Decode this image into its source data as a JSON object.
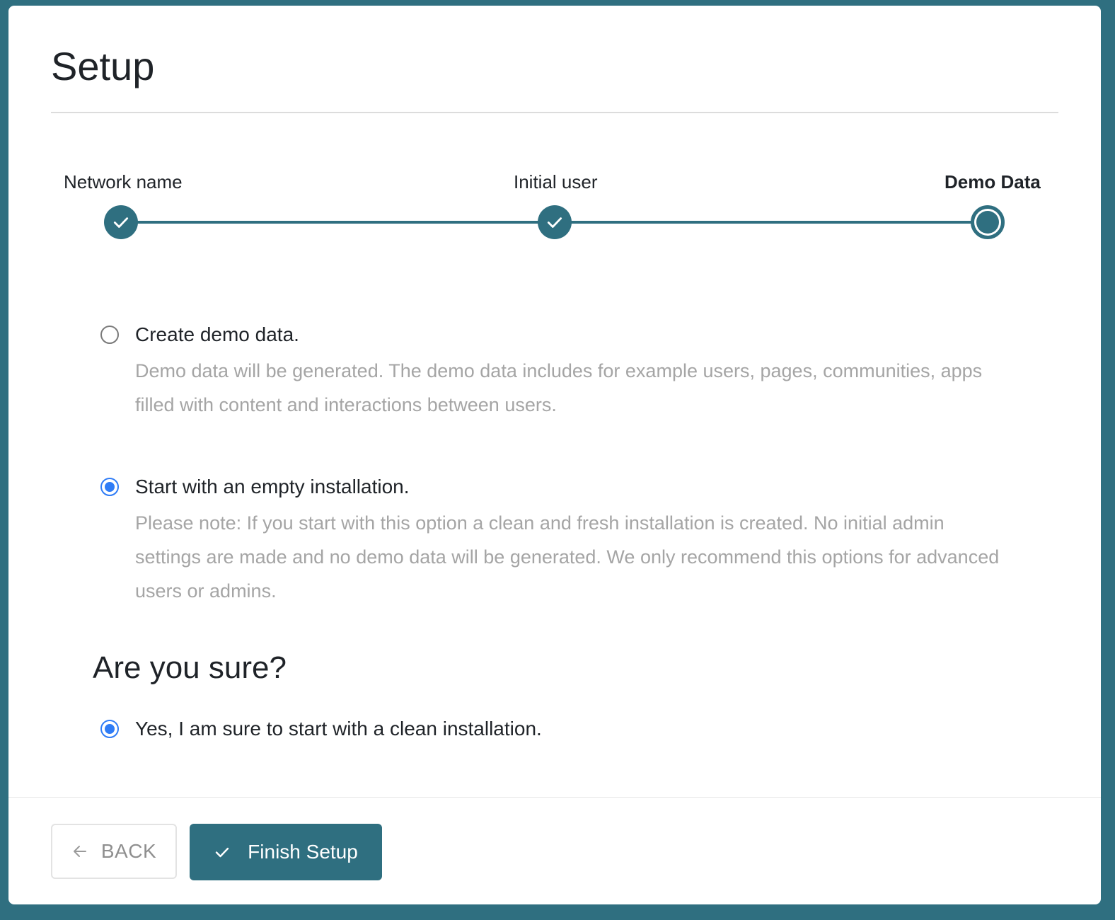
{
  "page": {
    "title": "Setup"
  },
  "stepper": {
    "steps": [
      {
        "label": "Network name",
        "state": "done"
      },
      {
        "label": "Initial user",
        "state": "done"
      },
      {
        "label": "Demo Data",
        "state": "current"
      }
    ],
    "accent_color": "#2f6f80",
    "check_icon": "check-icon"
  },
  "options": [
    {
      "label": "Create demo data.",
      "description": "Demo data will be generated. The demo data includes for example users, pages, communities, apps filled with content and interactions between users.",
      "selected": false
    },
    {
      "label": "Start with an empty installation.",
      "description": "Please note: If you start with this option a clean and fresh installation is created. No initial admin settings are made and no demo data will be generated. We only recommend this options for advanced users or admins.",
      "selected": true
    }
  ],
  "confirm": {
    "title": "Are you sure?",
    "label": "Yes, I am sure to start with a clean installation.",
    "selected": true
  },
  "footer": {
    "back_label": "BACK",
    "back_icon": "arrow-left-icon",
    "finish_label": "Finish Setup",
    "finish_icon": "check-icon"
  },
  "colors": {
    "primary": "#2f6f80",
    "radio_checked": "#2f7cf6",
    "muted_text": "#a5a5a5"
  }
}
